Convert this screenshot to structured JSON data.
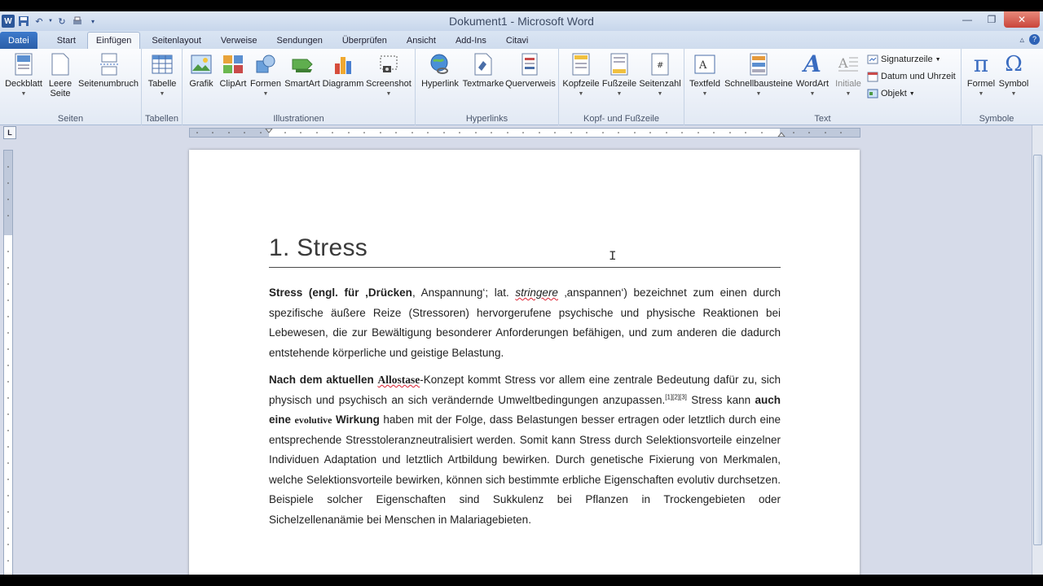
{
  "window": {
    "title": "Dokument1 - Microsoft Word"
  },
  "quick_access": {
    "logo": "W"
  },
  "tabs": [
    {
      "label": "Datei"
    },
    {
      "label": "Start"
    },
    {
      "label": "Einfügen"
    },
    {
      "label": "Seitenlayout"
    },
    {
      "label": "Verweise"
    },
    {
      "label": "Sendungen"
    },
    {
      "label": "Überprüfen"
    },
    {
      "label": "Ansicht"
    },
    {
      "label": "Add-Ins"
    },
    {
      "label": "Citavi"
    }
  ],
  "ribbon": {
    "groups": {
      "seiten": "Seiten",
      "tabellen": "Tabellen",
      "illustrationen": "Illustrationen",
      "hyperlinks": "Hyperlinks",
      "kopf": "Kopf- und Fußzeile",
      "text": "Text",
      "symbole": "Symbole"
    },
    "buttons": {
      "deckblatt": "Deckblatt",
      "leere_seite_1": "Leere",
      "leere_seite_2": "Seite",
      "seitenumbruch": "Seitenumbruch",
      "tabelle": "Tabelle",
      "grafik": "Grafik",
      "clipart": "ClipArt",
      "formen": "Formen",
      "smartart": "SmartArt",
      "diagramm": "Diagramm",
      "screenshot": "Screenshot",
      "hyperlink": "Hyperlink",
      "textmarke": "Textmarke",
      "querverweis": "Querverweis",
      "kopfzeile": "Kopfzeile",
      "fusszeile": "Fußzeile",
      "seitenzahl": "Seitenzahl",
      "textfeld": "Textfeld",
      "schnellbausteine": "Schnellbausteine",
      "wordart": "WordArt",
      "initiale": "Initiale",
      "signaturzeile": "Signaturzeile",
      "datum": "Datum und Uhrzeit",
      "objekt": "Objekt",
      "formel": "Formel",
      "symbol": "Symbol"
    }
  },
  "ruler": {
    "corner": "L"
  },
  "document": {
    "heading": "1. Stress",
    "p1": {
      "a": "Stress (engl. für ‚Drücken",
      "b": ", Anspannung‘; lat. ",
      "c": "stringere",
      "d": " ‚anspannen‘) bezeichnet zum einen durch spezifische äußere Reize (Stressoren) hervorgerufene psychische und physische Reaktionen bei Lebewesen, die zur Bewältigung besonderer Anforderungen befähigen, und zum anderen die dadurch entstehende körperliche und geistige Belastung."
    },
    "p2": {
      "a": "Nach dem aktuellen ",
      "b": "Allostase",
      "c": "-Konzept kommt Stress vor allem eine zentrale Bedeutung dafür zu, sich physisch und psychisch an sich verändernde Umweltbedingungen anzupassen.",
      "sup": "[1][2][3]",
      "d": " Stress kann ",
      "e": "auch eine ",
      "f": "evolutive",
      "g": " Wirkung",
      "h": " haben mit der Folge, dass Belastungen besser ertragen oder letztlich durch eine entsprechende Stresstoleranzneutralisiert werden. Somit kann Stress durch Selektionsvorteile einzelner Individuen Adaptation und letztlich Artbildung bewirken. Durch genetische Fixierung von Merkmalen, welche Selektionsvorteile bewirken, können sich bestimmte erbliche Eigenschaften evolutiv durchsetzen. Beispiele solcher Eigenschaften sind Sukkulenz bei Pflanzen in Trockengebieten oder Sichelzellenanämie bei Menschen in Malariagebieten."
    }
  }
}
